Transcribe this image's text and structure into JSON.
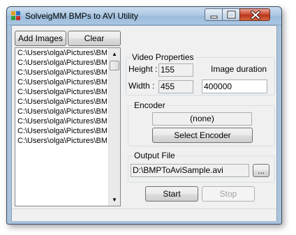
{
  "window": {
    "title": "SolveigMM BMPs to AVI Utility"
  },
  "toolbar": {
    "add_images_label": "Add Images",
    "clear_label": "Clear"
  },
  "file_list": {
    "items": [
      "C:\\Users\\olga\\Pictures\\BMP",
      "C:\\Users\\olga\\Pictures\\BMP",
      "C:\\Users\\olga\\Pictures\\BMP",
      "C:\\Users\\olga\\Pictures\\BMP",
      "C:\\Users\\olga\\Pictures\\BMP",
      "C:\\Users\\olga\\Pictures\\BMP",
      "C:\\Users\\olga\\Pictures\\BMP",
      "C:\\Users\\olga\\Pictures\\BMP",
      "C:\\Users\\olga\\Pictures\\BMP",
      "C:\\Users\\olga\\Pictures\\BMP"
    ]
  },
  "video_properties": {
    "title": "Video Properties",
    "height_label": "Height :",
    "height_value": "155",
    "width_label": "Width :",
    "width_value": "455",
    "duration_label": "Image duration",
    "duration_value": "400000"
  },
  "encoder": {
    "title": "Encoder",
    "current": "(none)",
    "select_label": "Select Encoder"
  },
  "output": {
    "title": "Output File",
    "path": "D:\\BMPToAviSample.avi",
    "browse_label": "..."
  },
  "actions": {
    "start_label": "Start",
    "stop_label": "Stop"
  },
  "colors": {
    "window_frame": "#a9c3dc",
    "client_bg": "#f0f0f0",
    "close_button": "#c9452c"
  }
}
